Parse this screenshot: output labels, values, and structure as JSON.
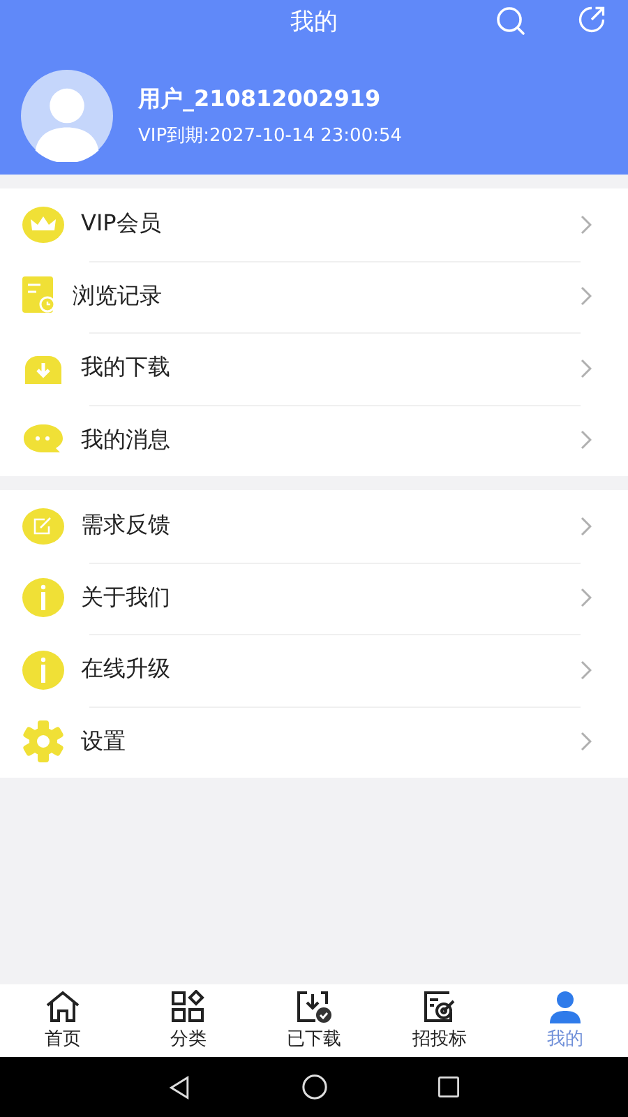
{
  "header": {
    "title": "我的"
  },
  "profile": {
    "username": "用户_210812002919",
    "vip_expiry": "VIP到期:2027-10-14 23:00:54"
  },
  "menu_groups": [
    {
      "items": [
        {
          "label": "VIP会员",
          "kind": "crown"
        },
        {
          "label": "浏览记录",
          "kind": "history"
        },
        {
          "label": "我的下载",
          "kind": "download"
        },
        {
          "label": "我的消息",
          "kind": "message"
        }
      ]
    },
    {
      "items": [
        {
          "label": "需求反馈",
          "kind": "feedback"
        },
        {
          "label": "关于我们",
          "kind": "info"
        },
        {
          "label": "在线升级",
          "kind": "info"
        },
        {
          "label": "设置",
          "kind": "settings"
        }
      ]
    }
  ],
  "tabs": [
    {
      "label": "首页",
      "kind": "home",
      "selected": false
    },
    {
      "label": "分类",
      "kind": "category",
      "selected": false
    },
    {
      "label": "已下载",
      "kind": "downloaded",
      "selected": false
    },
    {
      "label": "招投标",
      "kind": "bidding",
      "selected": false
    },
    {
      "label": "我的",
      "kind": "mine",
      "selected": true
    }
  ]
}
